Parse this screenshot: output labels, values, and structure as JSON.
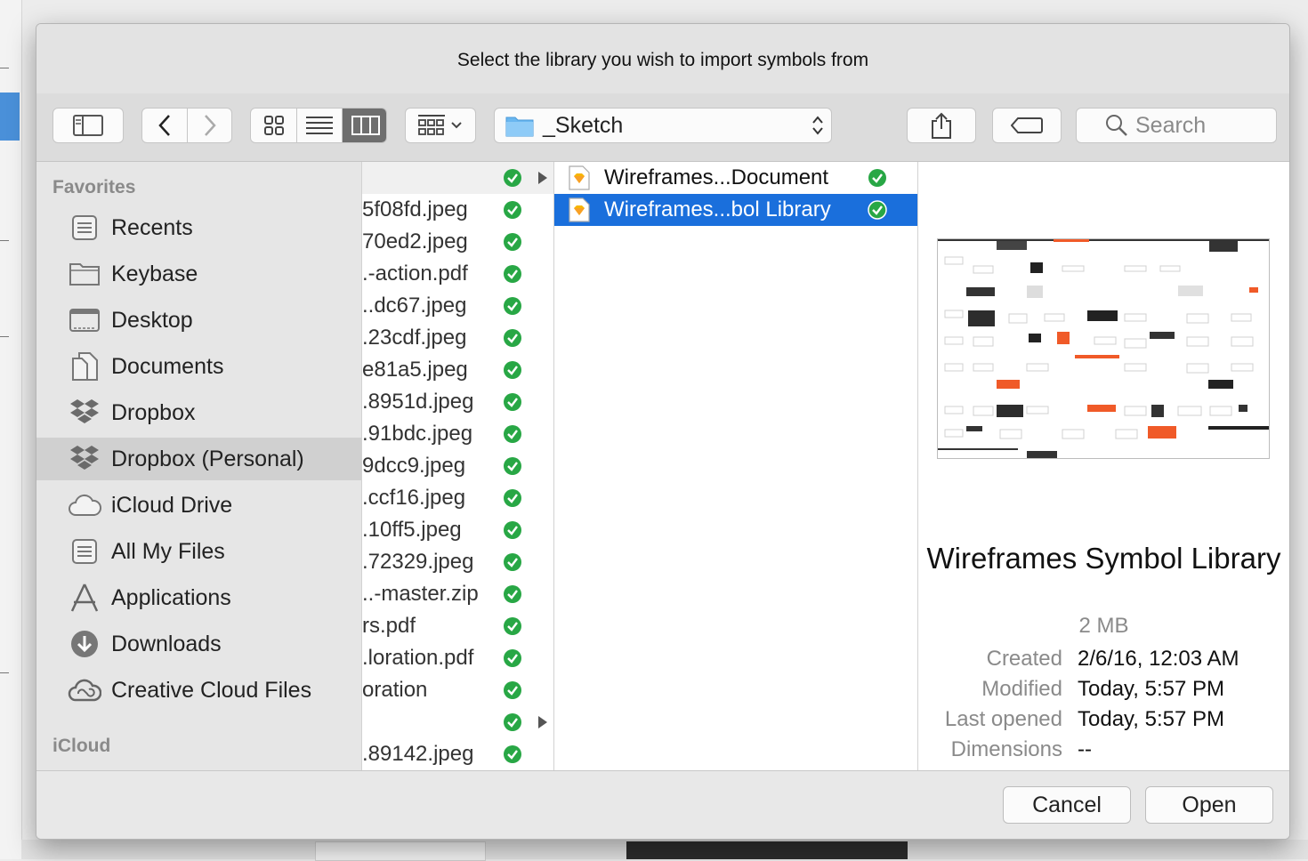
{
  "dialog": {
    "title": "Select the library you wish to import symbols from"
  },
  "toolbar": {
    "path_label": "_Sketch",
    "search_placeholder": "Search",
    "icons": [
      "sidebar-toggle-icon",
      "back-icon",
      "forward-icon",
      "icon-view-icon",
      "list-view-icon",
      "column-view-icon",
      "group-icon",
      "folder-icon",
      "share-icon",
      "tag-icon",
      "search-icon"
    ]
  },
  "sidebar": {
    "favorites_header": "Favorites",
    "icloud_header": "iCloud",
    "items": [
      {
        "label": "Recents",
        "icon": "recents-icon"
      },
      {
        "label": "Keybase",
        "icon": "folder-icon"
      },
      {
        "label": "Desktop",
        "icon": "desktop-icon"
      },
      {
        "label": "Documents",
        "icon": "documents-icon"
      },
      {
        "label": "Dropbox",
        "icon": "dropbox-icon"
      },
      {
        "label": "Dropbox (Personal)",
        "icon": "dropbox-icon",
        "selected": true
      },
      {
        "label": "iCloud Drive",
        "icon": "cloud-icon"
      },
      {
        "label": "All My Files",
        "icon": "all-files-icon"
      },
      {
        "label": "Applications",
        "icon": "applications-icon"
      },
      {
        "label": "Downloads",
        "icon": "downloads-icon"
      },
      {
        "label": "Creative Cloud Files",
        "icon": "creative-cloud-icon"
      }
    ]
  },
  "column1": {
    "rows": [
      {
        "name": "",
        "folder": true
      },
      {
        "name": "5f08fd.jpeg"
      },
      {
        "name": "70ed2.jpeg"
      },
      {
        "name": ".-action.pdf"
      },
      {
        "name": "..dc67.jpeg"
      },
      {
        "name": ".23cdf.jpeg"
      },
      {
        "name": "e81a5.jpeg"
      },
      {
        "name": ".8951d.jpeg"
      },
      {
        "name": ".91bdc.jpeg"
      },
      {
        "name": "9dcc9.jpeg"
      },
      {
        "name": ".ccf16.jpeg"
      },
      {
        "name": ".10ff5.jpeg"
      },
      {
        "name": ".72329.jpeg"
      },
      {
        "name": "..-master.zip"
      },
      {
        "name": "rs.pdf"
      },
      {
        "name": ".loration.pdf"
      },
      {
        "name": "oration"
      },
      {
        "name": "",
        "folder": true
      },
      {
        "name": ".89142.jpeg"
      }
    ]
  },
  "column2": {
    "rows": [
      {
        "name": "Wireframes...Document",
        "icon": "sketch-file-icon"
      },
      {
        "name": "Wireframes...bol Library",
        "icon": "sketch-file-icon",
        "selected": true
      }
    ]
  },
  "preview": {
    "name": "Wireframes Symbol Library",
    "size": "2 MB",
    "meta": [
      {
        "key": "Created",
        "value": "2/6/16, 12:03 AM"
      },
      {
        "key": "Modified",
        "value": "Today, 5:57 PM"
      },
      {
        "key": "Last opened",
        "value": "Today, 5:57 PM"
      },
      {
        "key": "Dimensions",
        "value": "--"
      }
    ]
  },
  "footer": {
    "cancel_label": "Cancel",
    "open_label": "Open"
  },
  "colors": {
    "selection": "#1a6fdc",
    "check": "#28a745",
    "accent_orange": "#f05a28"
  }
}
